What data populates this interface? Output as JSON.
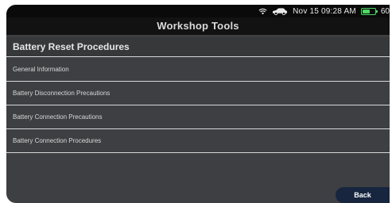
{
  "status_bar": {
    "date": "Nov 15",
    "time": "09:28 AM",
    "battery_percent": "60",
    "battery_level": 0.6,
    "icons": [
      "wifi-icon",
      "car-icon",
      "battery-icon"
    ],
    "battery_color": "#4cd964"
  },
  "header": {
    "title": "Workshop Tools"
  },
  "section": {
    "title": "Battery Reset Procedures"
  },
  "list": {
    "items": [
      {
        "label": "General Information"
      },
      {
        "label": "Battery Disconnection Precautions"
      },
      {
        "label": "Battery Connection Precautions"
      },
      {
        "label": "Battery Connection Procedures"
      }
    ]
  },
  "footer": {
    "back_label": "Back",
    "back_color": "#17253f"
  }
}
